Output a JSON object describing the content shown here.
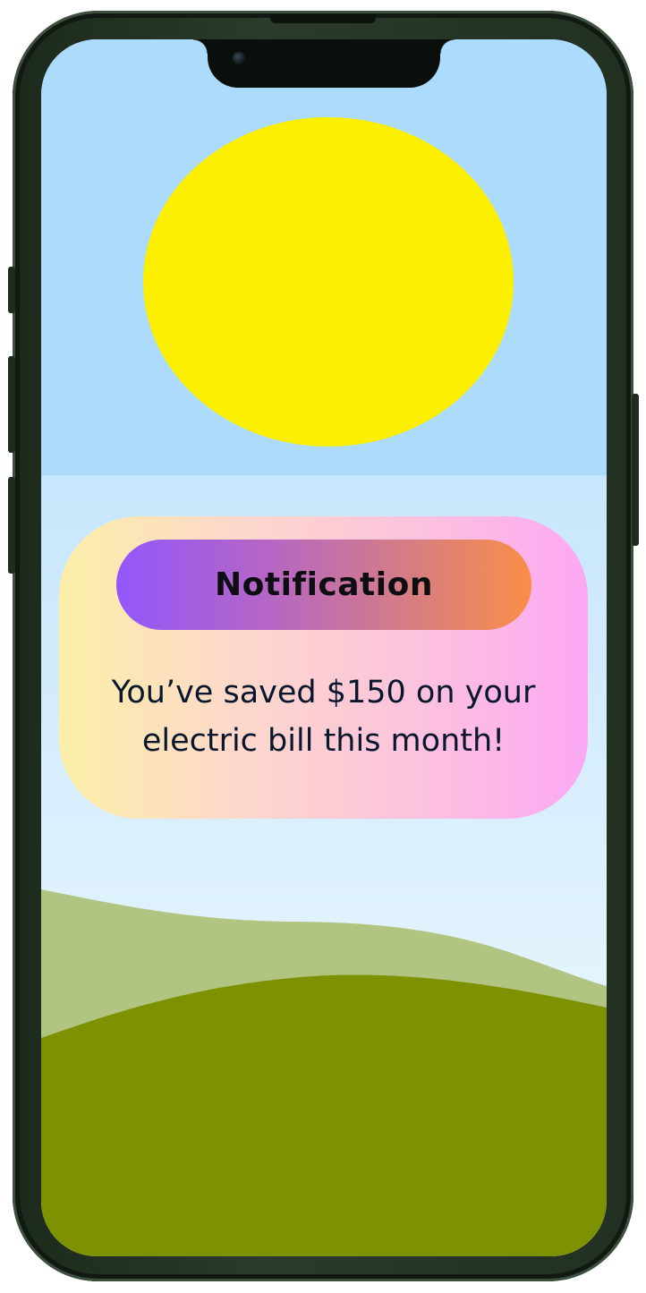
{
  "notification": {
    "title": "Notification",
    "message": "You’ve saved $150 on your electric bill this month!"
  },
  "colors": {
    "sky": "#addbfb",
    "sun": "#fdef00",
    "hill_back": "#b1c482",
    "hill_front": "#7e9100",
    "card_gradient": [
      "#fcefa8",
      "#fdd7cc",
      "#fca8f3"
    ],
    "pill_gradient": [
      "#9257fc",
      "#d07a8e",
      "#fa8d48"
    ],
    "frame": "#263426"
  },
  "icons": [
    "camera-icon"
  ]
}
